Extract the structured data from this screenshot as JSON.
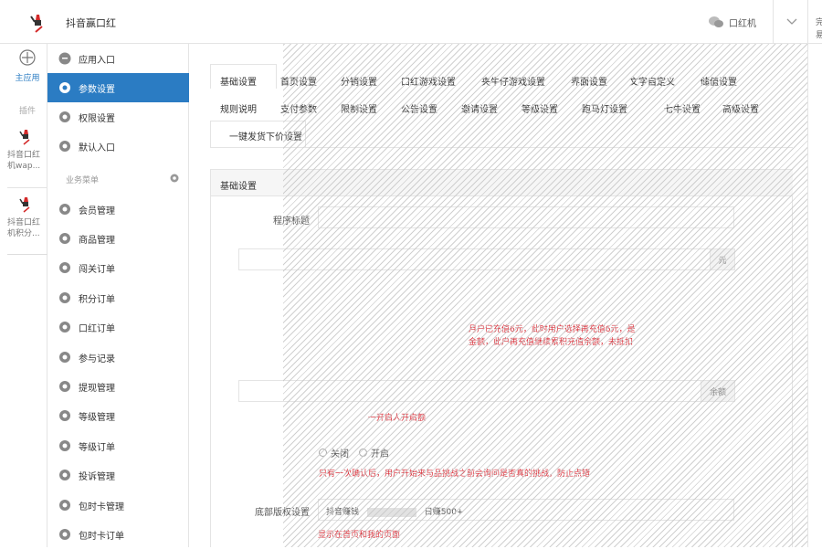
{
  "header": {
    "app_title": "抖音赢口红",
    "wechat_label": "口红机",
    "right_fragment": "完 易"
  },
  "rail": {
    "home_label": "主应用",
    "group_label": "插件",
    "apps": [
      {
        "label": "抖音口红 机wap..."
      },
      {
        "label": "抖音口红 机积分..."
      }
    ]
  },
  "menu": {
    "items_top": [
      {
        "label": "应用入口",
        "icon": "chat-icon"
      },
      {
        "label": "参数设置",
        "icon": "gear-icon",
        "active": true
      },
      {
        "label": "权限设置",
        "icon": "gear-icon"
      },
      {
        "label": "默认入口",
        "icon": "gear-icon"
      }
    ],
    "section_title": "业务菜单",
    "items_business": [
      {
        "label": "会员管理"
      },
      {
        "label": "商品管理"
      },
      {
        "label": "闯关订单"
      },
      {
        "label": "积分订单"
      },
      {
        "label": "口红订单"
      },
      {
        "label": "参与记录"
      },
      {
        "label": "提现管理"
      },
      {
        "label": "等级管理"
      },
      {
        "label": "等级订单"
      },
      {
        "label": "投诉管理"
      },
      {
        "label": "包时卡管理"
      },
      {
        "label": "包时卡订单"
      }
    ]
  },
  "tabs": {
    "row1": [
      "基础设置",
      "首页设置",
      "分销设置",
      "口红游戏设置",
      "夹牛仔游戏设置",
      "界面设置",
      "文字自定义",
      "储值设置"
    ],
    "row2": [
      "规则说明",
      "支付参数",
      "限制设置",
      "公告设置",
      "邀请设置",
      "等级设置",
      "跑马灯设置",
      "七牛设置",
      "高级设置"
    ],
    "row3": [
      "一键发货下价设置"
    ]
  },
  "panel": {
    "title": "基础设置",
    "fields": {
      "program_title_label": "程序标题",
      "program_title_placeholder": "",
      "yuan_addon": "元",
      "help_recharge": "月户已充值6元，此时用户选择再充值6元，是",
      "help_recharge2": "金额，此户再充值继续累积充值余额，未抵扣",
      "balance_addon": "余额",
      "help_balance": "一开启人开启额",
      "radio_close": "关闭",
      "radio_open": "开启",
      "help_confirm": "只有一次确认后，用户开始来与品挑战之前会询问是否真的挑战，防止点错",
      "bottom_label": "底部版权设置",
      "bottom_value": "抖音赚钱",
      "bottom_value_suffix": "日赚500+",
      "help_bottom": "显示在首页和我的页面"
    }
  }
}
